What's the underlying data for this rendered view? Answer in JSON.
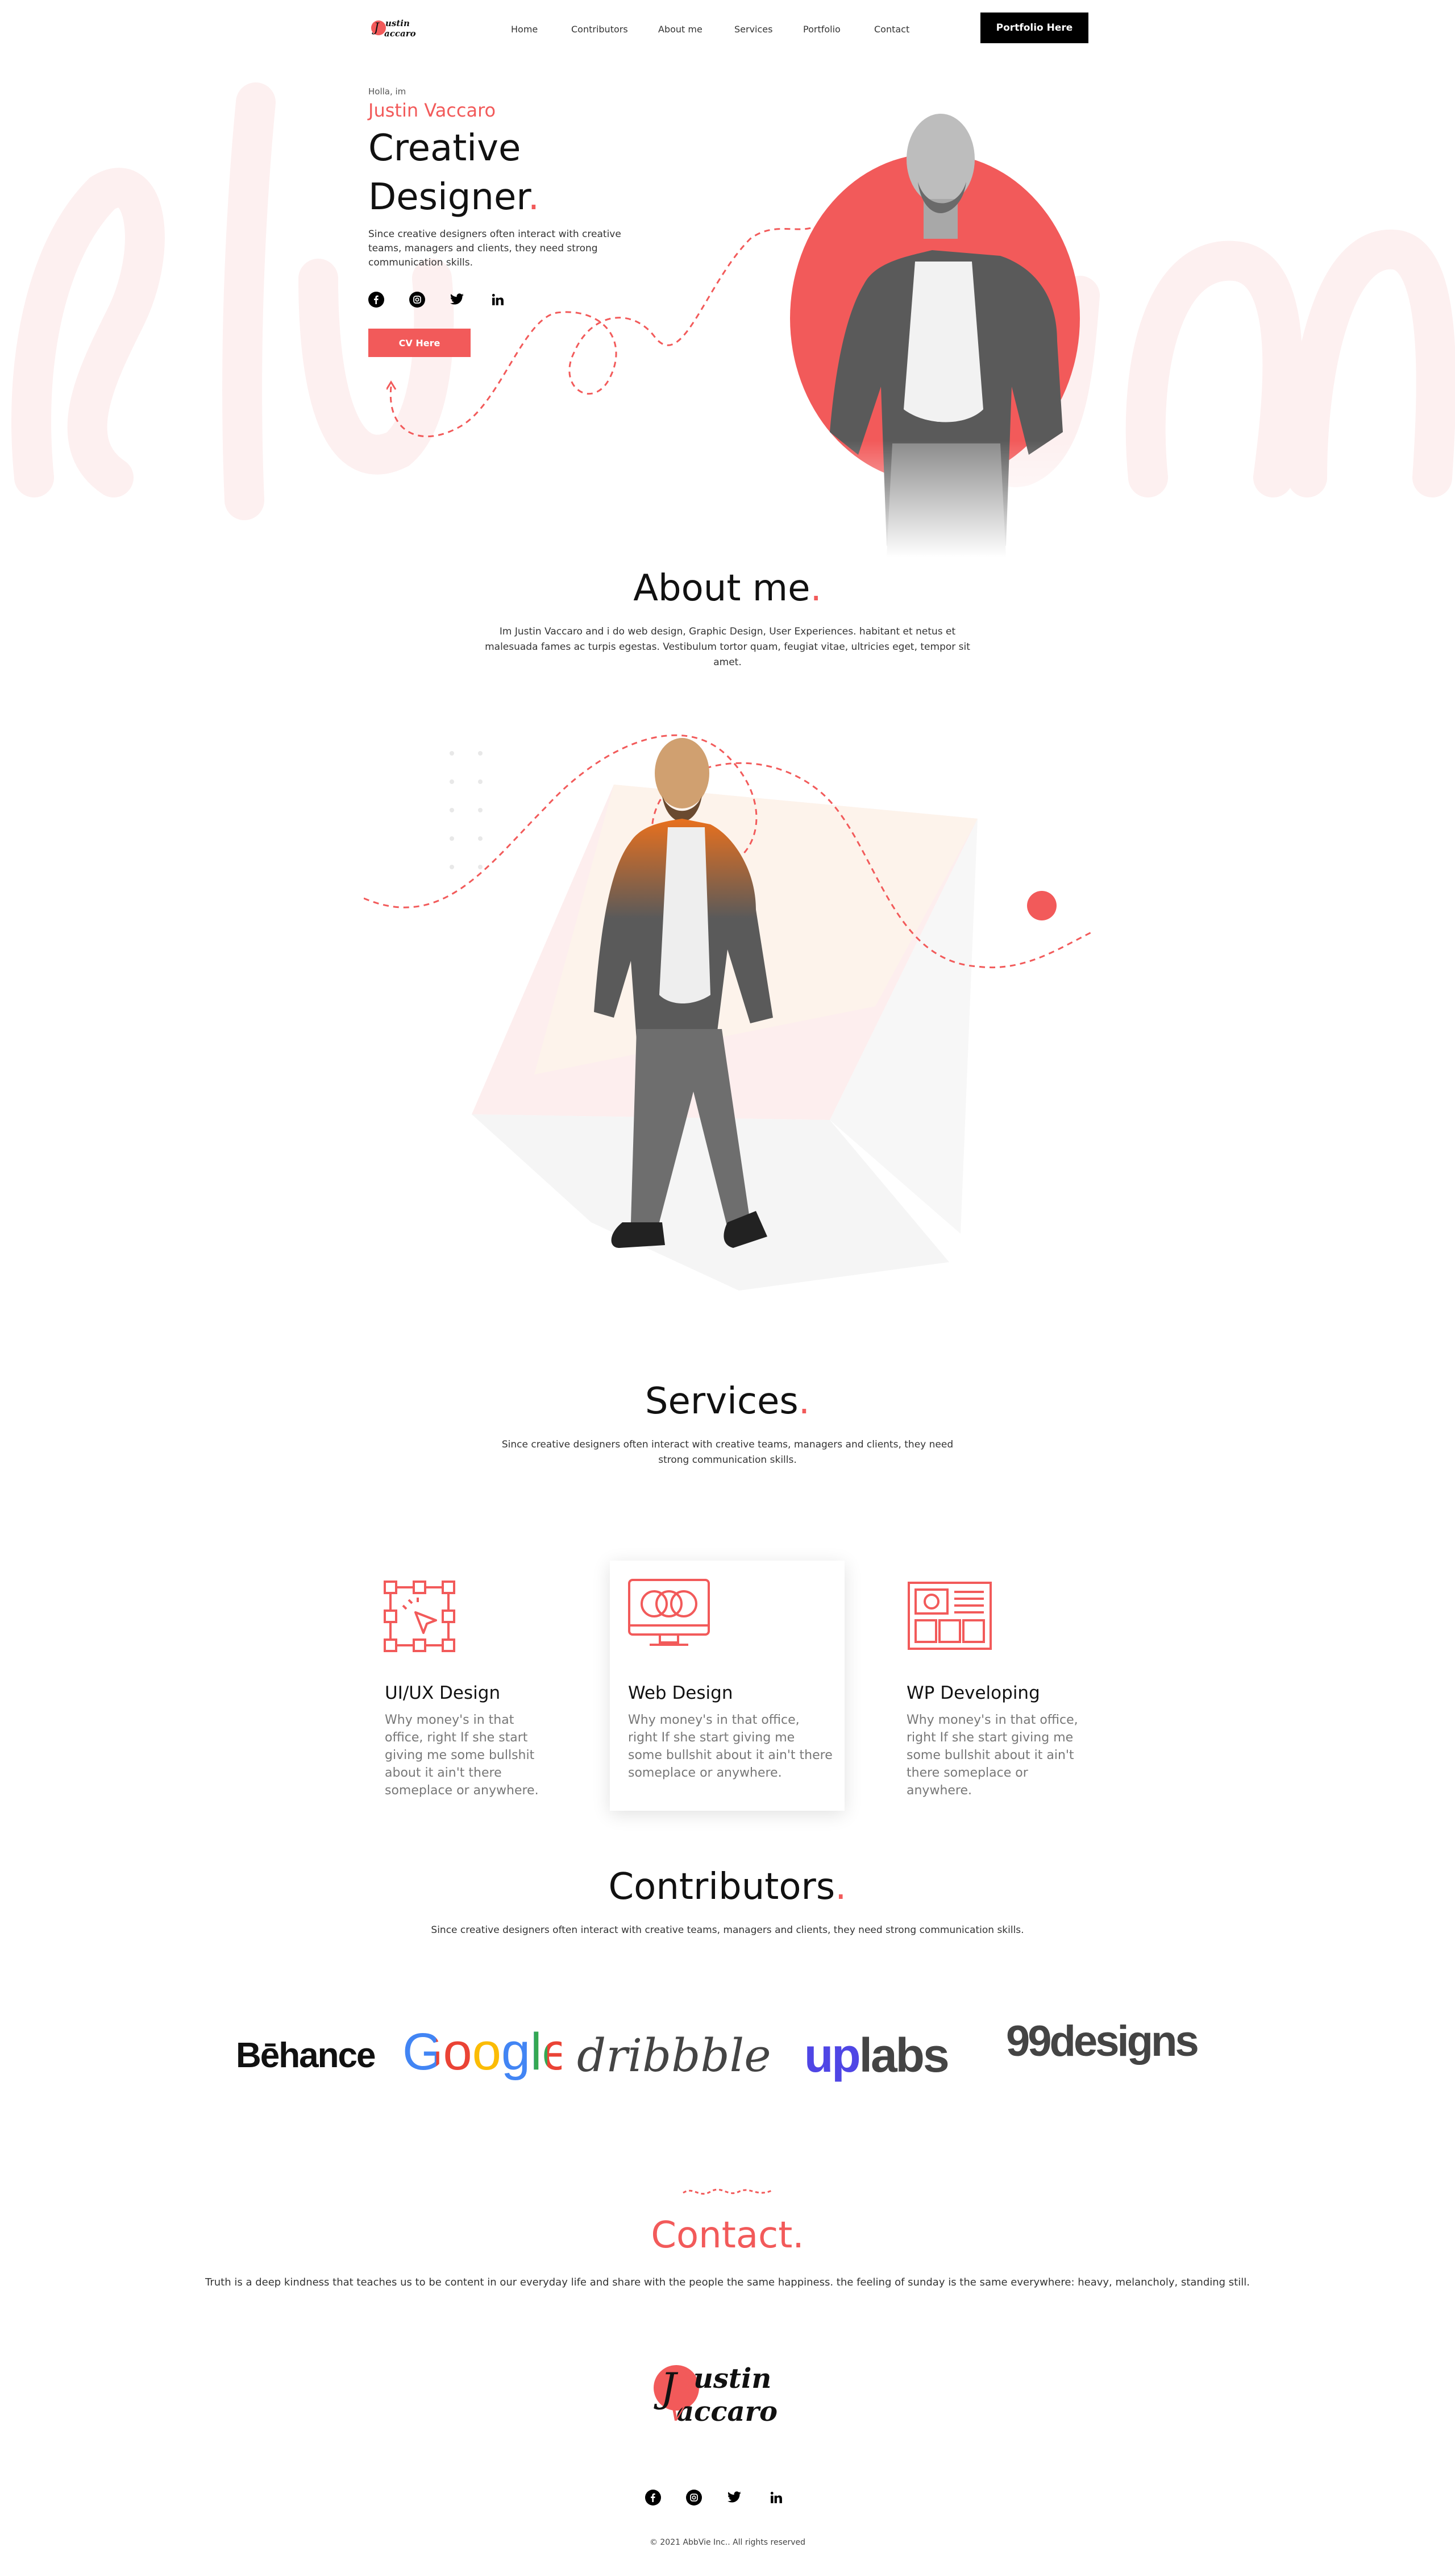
{
  "nav": {
    "links": [
      "Home",
      "Contributors",
      "About me",
      "Services",
      "Portfolio",
      "Contact"
    ],
    "cta": "Portfolio Here"
  },
  "hero": {
    "greeting": "Holla, im",
    "name": "Justin Vaccaro",
    "title_line1": "Creative",
    "title_line2": "Designer",
    "title_dot": ".",
    "description": "Since creative designers often interact with creative teams, managers and clients, they need strong communication skills.",
    "cv_button": "CV Here"
  },
  "social_icons": [
    "facebook-icon",
    "instagram-icon",
    "twitter-icon",
    "linkedin-icon"
  ],
  "about": {
    "title": "About me",
    "dot": ".",
    "text": "Im Justin Vaccaro and i do web design, Graphic Design, User Experiences. habitant et netus et malesuada fames ac turpis egestas. Vestibulum tortor quam, feugiat vitae, ultricies eget, tempor sit amet."
  },
  "services": {
    "title": "Services",
    "dot": ".",
    "text": "Since creative designers often interact with creative teams, managers and clients, they need strong communication skills.",
    "items": [
      {
        "title": "UI/UX Design",
        "text": "Why money's in that office, right If she start giving me some bullshit about it ain't there someplace or anywhere.",
        "icon": "ui-ux-icon"
      },
      {
        "title": "Web Design",
        "text": "Why money's in that office, right If she start giving me some bullshit about it ain't there someplace or anywhere.",
        "icon": "monitor-icon"
      },
      {
        "title": "WP Developing",
        "text": "Why money's in that office, right If she start giving me some bullshit about it ain't there someplace or anywhere.",
        "icon": "layout-icon"
      }
    ]
  },
  "contributors": {
    "title": "Contributors",
    "dot": ".",
    "text": "Since creative designers often interact with creative teams, managers and clients, they need strong communication skills.",
    "brands": [
      "Bēhance",
      "Google",
      "dribbble",
      "up",
      "labs",
      "99designs"
    ]
  },
  "contact": {
    "title": "Contact.",
    "text": "Truth is a deep kindness that teaches us to be content in our everyday life and share with the people the same happiness. the feeling of sunday is the same everywhere: heavy, melancholy, standing still."
  },
  "footer": {
    "copyright": "© 2021 AbbVie Inc.. All rights reserved"
  },
  "logo": {
    "line1": "ustin",
    "line2": "accaro",
    "initial_j": "J",
    "initial_v": "V"
  },
  "colors": {
    "accent": "#f25a5a",
    "dark": "#000000",
    "text": "#333333",
    "muted": "#777777",
    "brand_upwork": "#4f46e5"
  }
}
